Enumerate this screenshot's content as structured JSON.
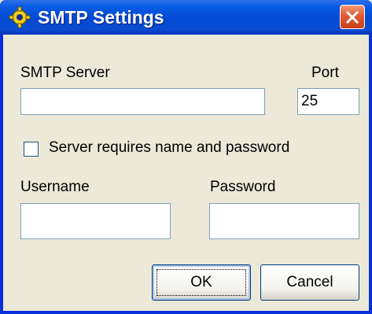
{
  "window": {
    "title": "SMTP Settings",
    "app_icon": "yellow-gear-icon",
    "close_icon": "close-icon"
  },
  "form": {
    "smtp_server_label": "SMTP Server",
    "smtp_server_value": "",
    "port_label": "Port",
    "port_value": "25",
    "auth_checkbox_label": "Server requires name and password",
    "auth_checkbox_checked": false,
    "username_label": "Username",
    "username_value": "",
    "password_label": "Password",
    "password_value": ""
  },
  "buttons": {
    "ok_label": "OK",
    "cancel_label": "Cancel"
  },
  "colors": {
    "title_bar": "#0a5ce5",
    "close_button": "#e15a31",
    "dialog_background": "#ece9d8"
  }
}
